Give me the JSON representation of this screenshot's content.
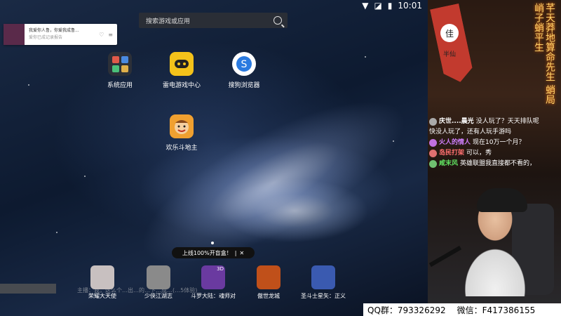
{
  "status_bar": {
    "time": "10:01"
  },
  "search": {
    "placeholder": "搜索游戏或应用"
  },
  "notification": {
    "title": "我爱你人鲁，你爱我成鲁...",
    "subtitle": "爱你已成记录报告"
  },
  "apps": [
    {
      "label": "系统应用",
      "icon": "system-apps-icon"
    },
    {
      "label": "雷电游戏中心",
      "icon": "gamepad-icon"
    },
    {
      "label": "搜狗浏览器",
      "icon": "sogou-browser-icon"
    },
    {
      "label": "欢乐斗地主",
      "icon": "doudizhu-icon"
    }
  ],
  "banner": {
    "text": "上线100%开盲盒！",
    "sep": "|",
    "close": "✕"
  },
  "dock": [
    {
      "label": "荣耀大天使",
      "color": "#c8c0c0"
    },
    {
      "label": "少侠江湖志",
      "color": "#8a8a8a"
    },
    {
      "label": "斗罗大陆：魂师对",
      "color": "#6a3aa0",
      "badge": "3D"
    },
    {
      "label": "傲世龙城",
      "color": "#c0501a"
    },
    {
      "label": "圣斗士星矢：正义",
      "color": "#3a5ab0"
    }
  ],
  "overlay_chat": "主播：我，这么个…出…的…下…成…(…5体验)",
  "stream": {
    "flag_glyph": "佳",
    "flag_text": "半仙",
    "calligraphy": "芊天莽地算命先生  蛸局峭子蛸平生",
    "chat": [
      {
        "name": "庆世....晨光",
        "text": "没人玩了？天天排队呢",
        "name_color": "#ffffff",
        "text_color": "#ffffff"
      },
      {
        "name": "",
        "text": "快没人玩了，还有人玩手游吗",
        "name_color": "#ffffff",
        "text_color": "#ffffff"
      },
      {
        "name": "火人的情人",
        "text": "现在10万一个月？",
        "name_color": "#d080ff",
        "text_color": "#ffffff"
      },
      {
        "name": "岛民打架",
        "text": "可以，秀",
        "name_color": "#ff7070",
        "text_color": "#ffffff"
      },
      {
        "name": "咸末风",
        "text": "英雄联盟我直接都不看的，",
        "name_color": "#60e060",
        "text_color": "#ffffff"
      }
    ],
    "qq_group": "QQ群：793326292",
    "wechat": "微信：F417386155"
  }
}
